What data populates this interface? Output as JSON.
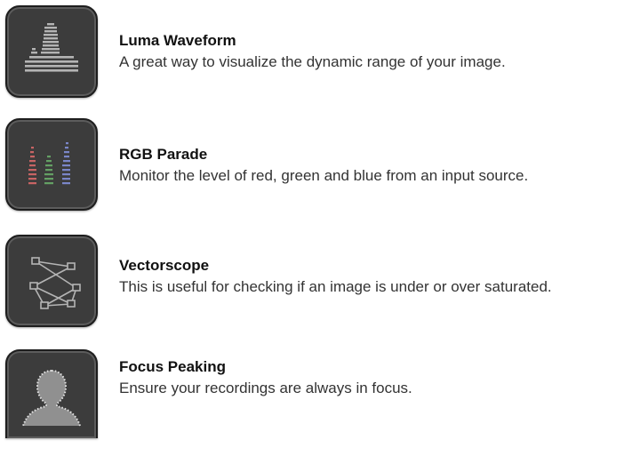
{
  "features": [
    {
      "icon": "luma-waveform-icon",
      "title": "Luma Waveform",
      "description": "A great way to visualize the dynamic range of your image."
    },
    {
      "icon": "rgb-parade-icon",
      "title": "RGB Parade",
      "description": "Monitor the level of red, green and blue from an input source."
    },
    {
      "icon": "vectorscope-icon",
      "title": "Vectorscope",
      "description": "This is useful for checking if an image is under or over saturated."
    },
    {
      "icon": "focus-peaking-icon",
      "title": "Focus Peaking",
      "description": "Ensure your recordings are always in focus."
    }
  ],
  "colors": {
    "tile_background": "#3c3c3c",
    "icon_gray": "#b4b4b4",
    "rgb_red": "#c86464",
    "rgb_green": "#64a064",
    "rgb_blue": "#7a86c8"
  }
}
